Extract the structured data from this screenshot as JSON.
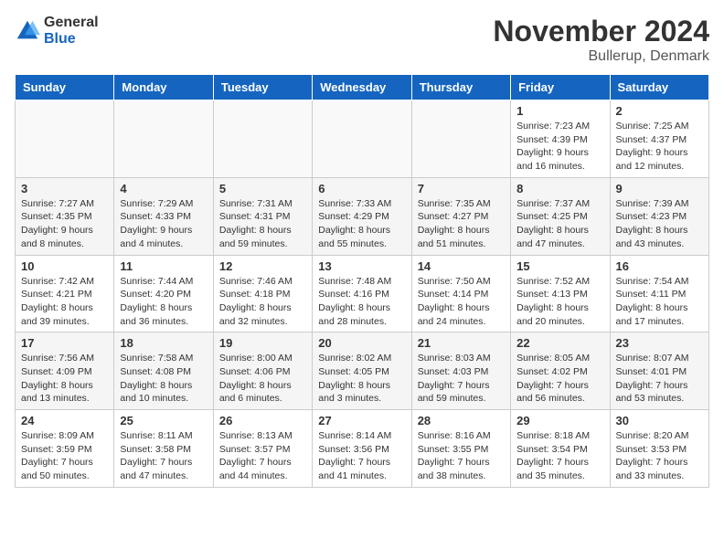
{
  "header": {
    "logo_general": "General",
    "logo_blue": "Blue",
    "month_title": "November 2024",
    "location": "Bullerup, Denmark"
  },
  "weekdays": [
    "Sunday",
    "Monday",
    "Tuesday",
    "Wednesday",
    "Thursday",
    "Friday",
    "Saturday"
  ],
  "weeks": [
    [
      {
        "day": "",
        "info": ""
      },
      {
        "day": "",
        "info": ""
      },
      {
        "day": "",
        "info": ""
      },
      {
        "day": "",
        "info": ""
      },
      {
        "day": "",
        "info": ""
      },
      {
        "day": "1",
        "info": "Sunrise: 7:23 AM\nSunset: 4:39 PM\nDaylight: 9 hours and 16 minutes."
      },
      {
        "day": "2",
        "info": "Sunrise: 7:25 AM\nSunset: 4:37 PM\nDaylight: 9 hours and 12 minutes."
      }
    ],
    [
      {
        "day": "3",
        "info": "Sunrise: 7:27 AM\nSunset: 4:35 PM\nDaylight: 9 hours and 8 minutes."
      },
      {
        "day": "4",
        "info": "Sunrise: 7:29 AM\nSunset: 4:33 PM\nDaylight: 9 hours and 4 minutes."
      },
      {
        "day": "5",
        "info": "Sunrise: 7:31 AM\nSunset: 4:31 PM\nDaylight: 8 hours and 59 minutes."
      },
      {
        "day": "6",
        "info": "Sunrise: 7:33 AM\nSunset: 4:29 PM\nDaylight: 8 hours and 55 minutes."
      },
      {
        "day": "7",
        "info": "Sunrise: 7:35 AM\nSunset: 4:27 PM\nDaylight: 8 hours and 51 minutes."
      },
      {
        "day": "8",
        "info": "Sunrise: 7:37 AM\nSunset: 4:25 PM\nDaylight: 8 hours and 47 minutes."
      },
      {
        "day": "9",
        "info": "Sunrise: 7:39 AM\nSunset: 4:23 PM\nDaylight: 8 hours and 43 minutes."
      }
    ],
    [
      {
        "day": "10",
        "info": "Sunrise: 7:42 AM\nSunset: 4:21 PM\nDaylight: 8 hours and 39 minutes."
      },
      {
        "day": "11",
        "info": "Sunrise: 7:44 AM\nSunset: 4:20 PM\nDaylight: 8 hours and 36 minutes."
      },
      {
        "day": "12",
        "info": "Sunrise: 7:46 AM\nSunset: 4:18 PM\nDaylight: 8 hours and 32 minutes."
      },
      {
        "day": "13",
        "info": "Sunrise: 7:48 AM\nSunset: 4:16 PM\nDaylight: 8 hours and 28 minutes."
      },
      {
        "day": "14",
        "info": "Sunrise: 7:50 AM\nSunset: 4:14 PM\nDaylight: 8 hours and 24 minutes."
      },
      {
        "day": "15",
        "info": "Sunrise: 7:52 AM\nSunset: 4:13 PM\nDaylight: 8 hours and 20 minutes."
      },
      {
        "day": "16",
        "info": "Sunrise: 7:54 AM\nSunset: 4:11 PM\nDaylight: 8 hours and 17 minutes."
      }
    ],
    [
      {
        "day": "17",
        "info": "Sunrise: 7:56 AM\nSunset: 4:09 PM\nDaylight: 8 hours and 13 minutes."
      },
      {
        "day": "18",
        "info": "Sunrise: 7:58 AM\nSunset: 4:08 PM\nDaylight: 8 hours and 10 minutes."
      },
      {
        "day": "19",
        "info": "Sunrise: 8:00 AM\nSunset: 4:06 PM\nDaylight: 8 hours and 6 minutes."
      },
      {
        "day": "20",
        "info": "Sunrise: 8:02 AM\nSunset: 4:05 PM\nDaylight: 8 hours and 3 minutes."
      },
      {
        "day": "21",
        "info": "Sunrise: 8:03 AM\nSunset: 4:03 PM\nDaylight: 7 hours and 59 minutes."
      },
      {
        "day": "22",
        "info": "Sunrise: 8:05 AM\nSunset: 4:02 PM\nDaylight: 7 hours and 56 minutes."
      },
      {
        "day": "23",
        "info": "Sunrise: 8:07 AM\nSunset: 4:01 PM\nDaylight: 7 hours and 53 minutes."
      }
    ],
    [
      {
        "day": "24",
        "info": "Sunrise: 8:09 AM\nSunset: 3:59 PM\nDaylight: 7 hours and 50 minutes."
      },
      {
        "day": "25",
        "info": "Sunrise: 8:11 AM\nSunset: 3:58 PM\nDaylight: 7 hours and 47 minutes."
      },
      {
        "day": "26",
        "info": "Sunrise: 8:13 AM\nSunset: 3:57 PM\nDaylight: 7 hours and 44 minutes."
      },
      {
        "day": "27",
        "info": "Sunrise: 8:14 AM\nSunset: 3:56 PM\nDaylight: 7 hours and 41 minutes."
      },
      {
        "day": "28",
        "info": "Sunrise: 8:16 AM\nSunset: 3:55 PM\nDaylight: 7 hours and 38 minutes."
      },
      {
        "day": "29",
        "info": "Sunrise: 8:18 AM\nSunset: 3:54 PM\nDaylight: 7 hours and 35 minutes."
      },
      {
        "day": "30",
        "info": "Sunrise: 8:20 AM\nSunset: 3:53 PM\nDaylight: 7 hours and 33 minutes."
      }
    ]
  ]
}
